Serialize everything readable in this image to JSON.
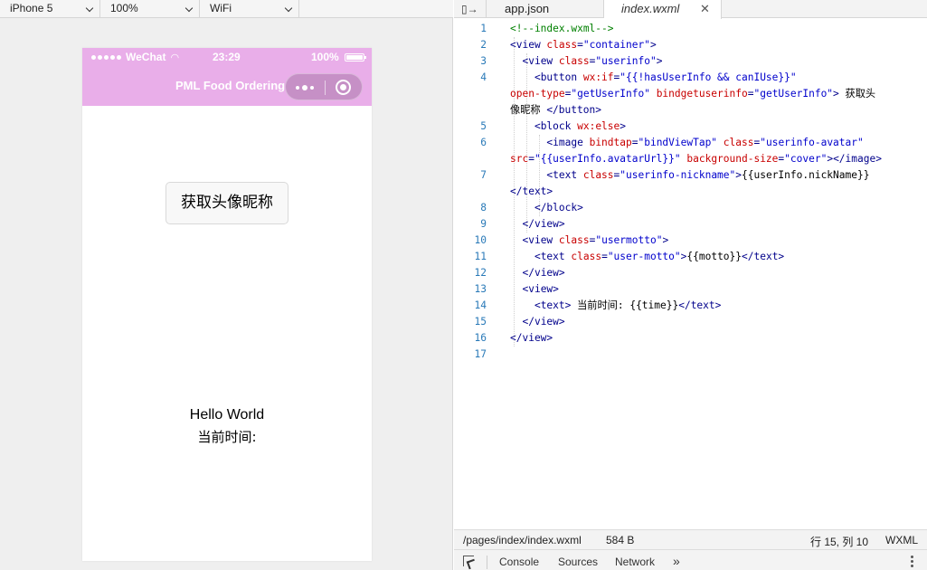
{
  "simulator": {
    "device": "iPhone 5",
    "zoom": "100%",
    "network": "WiFi",
    "statusbar": {
      "carrier": "WeChat",
      "time": "23:29",
      "battery": "100%"
    },
    "nav_title": "PML Food Ordering",
    "get_userinfo_button": "获取头像昵称",
    "motto": "Hello World",
    "time_label": "当前时间:"
  },
  "editor": {
    "tabs": [
      {
        "label": "app.json"
      },
      {
        "label": "index.wxml",
        "active": true
      }
    ],
    "lines": [
      {
        "n": "1"
      },
      {
        "n": "2"
      },
      {
        "n": "3"
      },
      {
        "n": "4"
      },
      {
        "n": "5"
      },
      {
        "n": "6"
      },
      {
        "n": "7"
      },
      {
        "n": "8"
      },
      {
        "n": "9"
      },
      {
        "n": "10"
      },
      {
        "n": "11"
      },
      {
        "n": "12"
      },
      {
        "n": "13"
      },
      {
        "n": "14"
      },
      {
        "n": "15"
      },
      {
        "n": "16"
      },
      {
        "n": "17"
      }
    ],
    "status": {
      "path": "/pages/index/index.wxml",
      "size": "584 B",
      "cursor": "行 15, 列 10",
      "language": "WXML"
    },
    "devtools_tabs": [
      "Console",
      "Sources",
      "Network"
    ],
    "devtools_more": "»"
  },
  "colors": {
    "nav_bg": "#e9aee9",
    "line_number": "#2a7ab8",
    "tag": "#00008b",
    "attribute": "#c80000",
    "string": "#0000cc",
    "comment": "#008000"
  }
}
